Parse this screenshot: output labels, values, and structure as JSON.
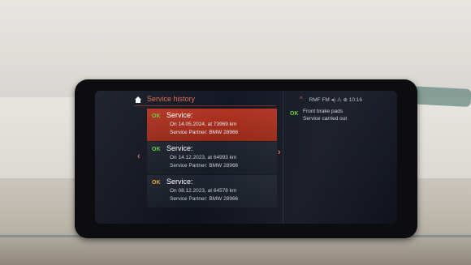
{
  "header": {
    "title": "Service history",
    "status": "RMF FM  ◂)  ⚠  ⊕ 10:16"
  },
  "list": {
    "items": [
      {
        "badge": "OK",
        "name": "Service:",
        "line1": "On 14.05.2024, at 73969 km",
        "line2": "Service Partner: BMW 28966"
      },
      {
        "badge": "OK",
        "name": "Service:",
        "line1": "On 14.12.2023, at 64993 km",
        "line2": "Service Partner: BMW 28966"
      },
      {
        "badge": "OK",
        "name": "Service:",
        "line1": "On 08.12.2023, at 64578 km",
        "line2": "Service Partner: BMW 28966"
      }
    ]
  },
  "detail": {
    "badge": "OK",
    "line1": "Front brake pads",
    "line2": "Service carried out"
  },
  "colors": {
    "accent": "#e36a53",
    "selected_bg": "#b23423",
    "ok_green": "#5fcf3c",
    "ok_amber": "#f0a13a"
  },
  "icons": {
    "home": "home-icon",
    "left": "chevron-left-icon",
    "right": "chevron-right-icon",
    "up": "chevron-up-icon"
  }
}
